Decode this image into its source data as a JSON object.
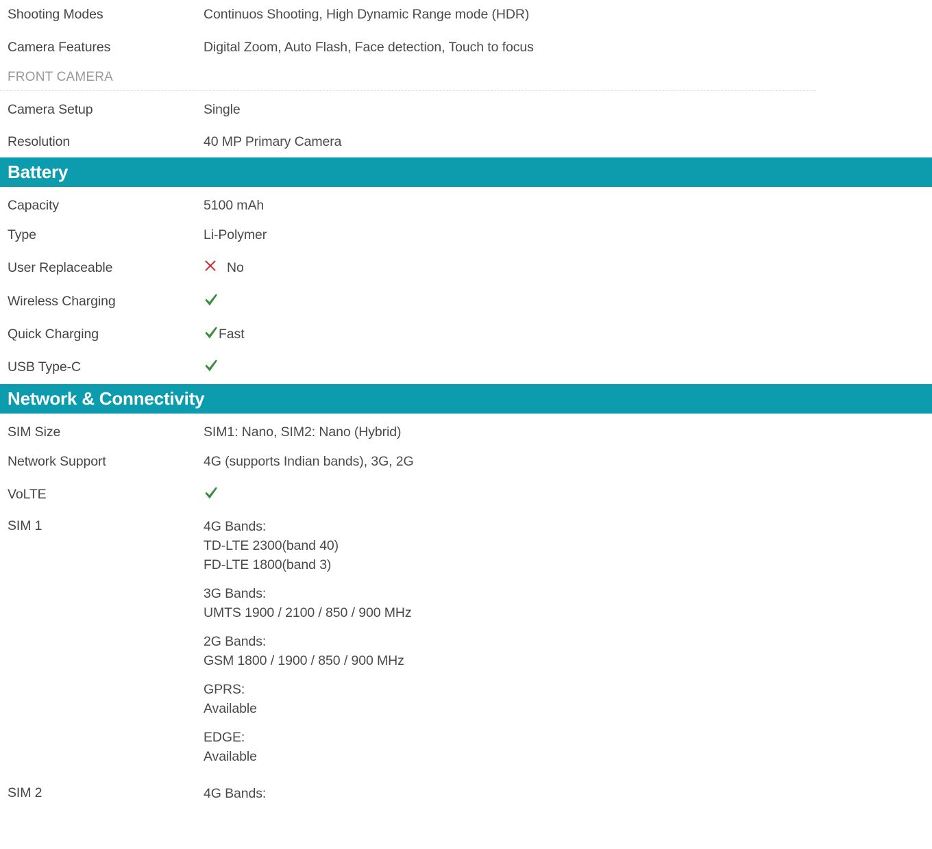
{
  "colors": {
    "section_header_bg": "#0d9cad",
    "section_header_text": "#ffffff",
    "check_green": "#3d8b40",
    "cross_red": "#cf2a27",
    "label_text": "#454545",
    "value_text": "#4a4a4a",
    "subsection_text": "#9a9a9a",
    "divider": "#dcdcdc"
  },
  "rear_camera_tail": {
    "rows": [
      {
        "label": "Shooting Modes",
        "value": "Continuos Shooting, High Dynamic Range mode (HDR)"
      },
      {
        "label": "Camera Features",
        "value": "Digital Zoom, Auto Flash, Face detection, Touch to focus"
      }
    ]
  },
  "front_camera": {
    "subsection_title": "FRONT CAMERA",
    "rows": [
      {
        "label": "Camera Setup",
        "value": "Single"
      },
      {
        "label": "Resolution",
        "value": "40 MP Primary Camera"
      }
    ]
  },
  "battery": {
    "section_title": "Battery",
    "rows": [
      {
        "label": "Capacity",
        "value": "5100 mAh"
      },
      {
        "label": "Type",
        "value": "Li-Polymer"
      },
      {
        "label": "User Replaceable",
        "icon": "cross-icon",
        "value": "No"
      },
      {
        "label": "Wireless Charging",
        "icon": "check-icon",
        "value": ""
      },
      {
        "label": "Quick Charging",
        "icon": "check-icon",
        "value": "Fast"
      },
      {
        "label": "USB Type-C",
        "icon": "check-icon",
        "value": ""
      }
    ]
  },
  "network": {
    "section_title": "Network & Connectivity",
    "rows": [
      {
        "label": "SIM Size",
        "value": "SIM1: Nano, SIM2: Nano (Hybrid)"
      },
      {
        "label": "Network Support",
        "value": "4G (supports Indian bands), 3G, 2G"
      },
      {
        "label": "VoLTE",
        "icon": "check-icon",
        "value": ""
      }
    ],
    "sim1": {
      "label": "SIM 1",
      "groups": [
        {
          "heading": "4G Bands:",
          "lines": [
            "TD-LTE 2300(band 40)",
            "FD-LTE 1800(band 3)"
          ]
        },
        {
          "heading": "3G Bands:",
          "lines": [
            "UMTS 1900 / 2100 / 850 / 900 MHz"
          ]
        },
        {
          "heading": "2G Bands:",
          "lines": [
            "GSM 1800 / 1900 / 850 / 900 MHz"
          ]
        },
        {
          "heading": "GPRS:",
          "lines": [
            "Available"
          ]
        },
        {
          "heading": "EDGE:",
          "lines": [
            "Available"
          ]
        }
      ]
    },
    "sim2": {
      "label": "SIM 2",
      "groups": [
        {
          "heading": "4G Bands:",
          "lines": []
        }
      ]
    }
  }
}
